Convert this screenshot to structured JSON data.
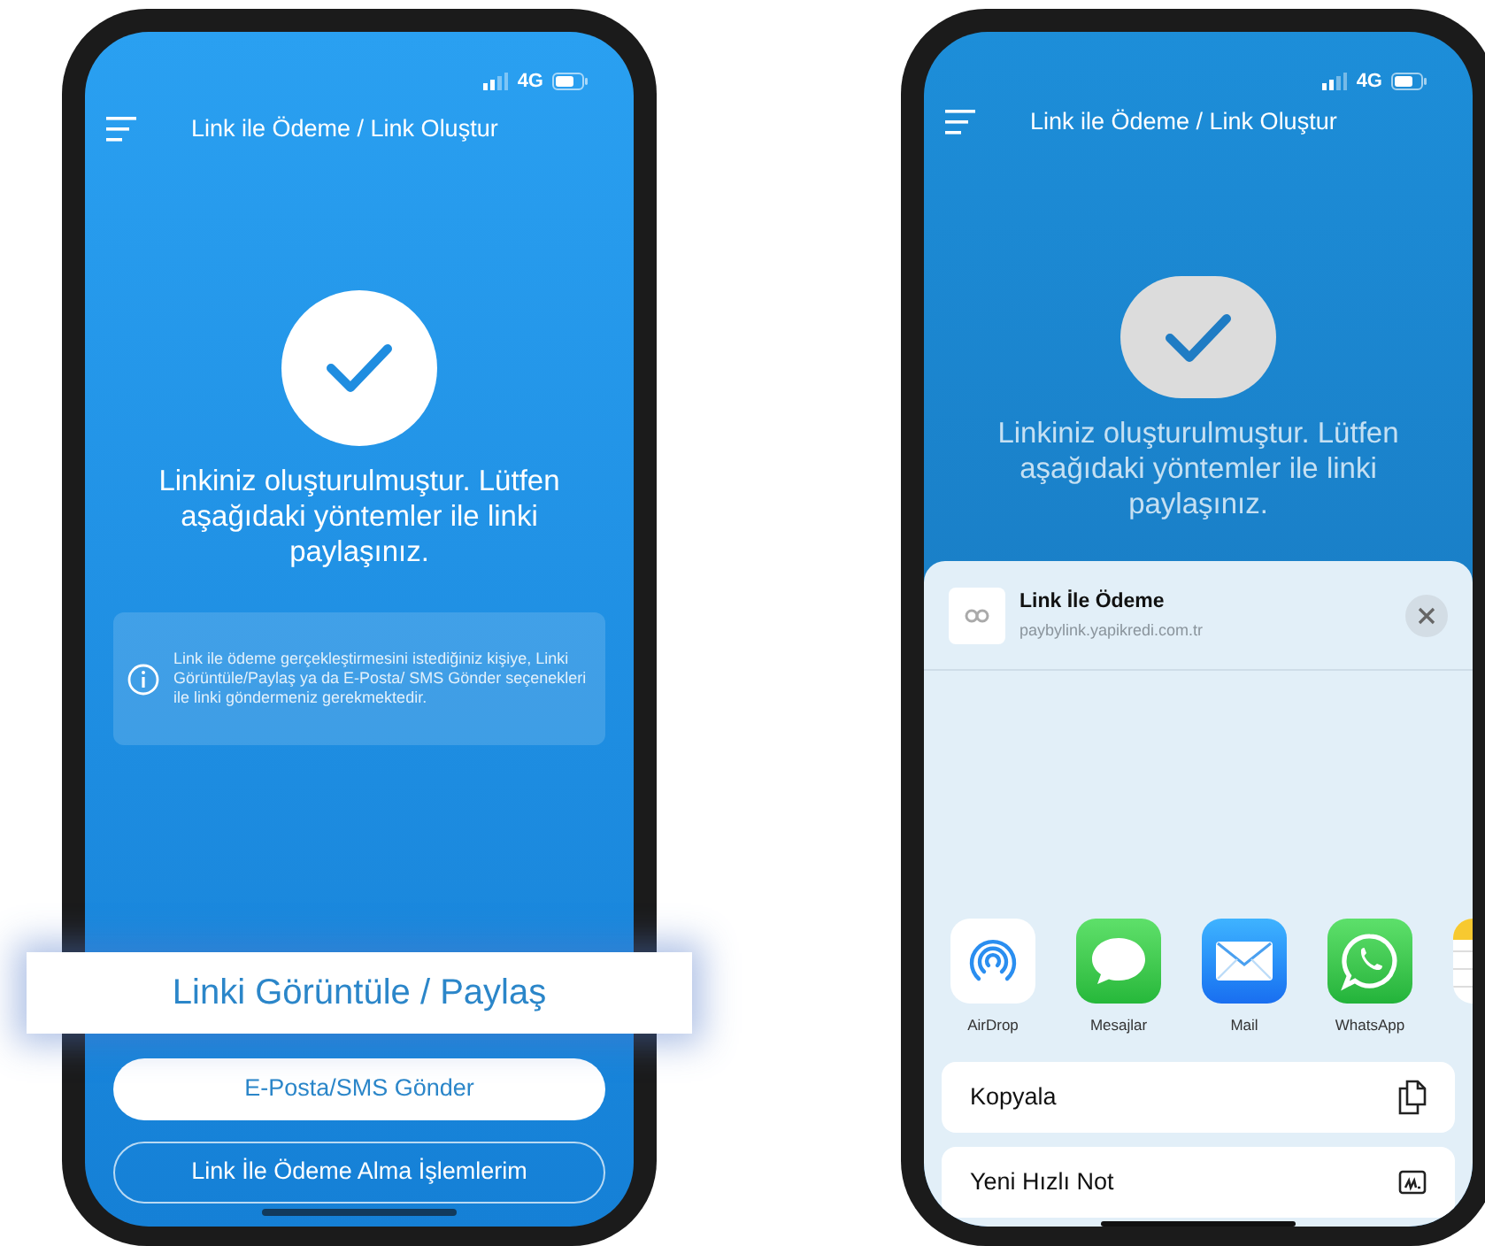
{
  "left_phone": {
    "status_bar": {
      "network": "4G"
    },
    "header": {
      "title": "Link ile Ödeme / Link Oluştur"
    },
    "message": "Linkiniz oluşturulmuştur. Lütfen aşağıdaki yöntemler ile linki paylaşınız.",
    "info": "Link ile ödeme gerçekleştirmesini istediğiniz kişiye, Linki Görüntüle/Paylaş ya da E-Posta/ SMS Gönder seçenekleri ile linki göndermeniz gerekmektedir.",
    "buttons": [
      {
        "label": "Linki Görüntüle / Paylaş",
        "kind": "highlight"
      },
      {
        "label": "E-Posta/SMS Gönder",
        "kind": "filled"
      },
      {
        "label": "Link İle Ödeme Alma İşlemlerim",
        "kind": "outline"
      }
    ]
  },
  "right_phone": {
    "status_bar": {
      "network": "4G"
    },
    "header": {
      "title": "Link ile Ödeme / Link Oluştur"
    },
    "message": "Linkiniz oluşturulmuştur. Lütfen aşağıdaki yöntemler ile linki paylaşınız.",
    "share_sheet": {
      "title": "Link İle Ödeme",
      "url": "paybylink.yapikredi.com.tr",
      "apps": [
        {
          "label": "AirDrop",
          "kind": "airdrop"
        },
        {
          "label": "Mesajlar",
          "kind": "messages"
        },
        {
          "label": "Mail",
          "kind": "mail"
        },
        {
          "label": "WhatsApp",
          "kind": "whatsapp"
        },
        {
          "kind": "notes"
        }
      ],
      "actions": [
        {
          "label": "Kopyala",
          "kind": "copy"
        },
        {
          "label": "Yeni Hızlı Not",
          "kind": "note"
        }
      ]
    }
  }
}
